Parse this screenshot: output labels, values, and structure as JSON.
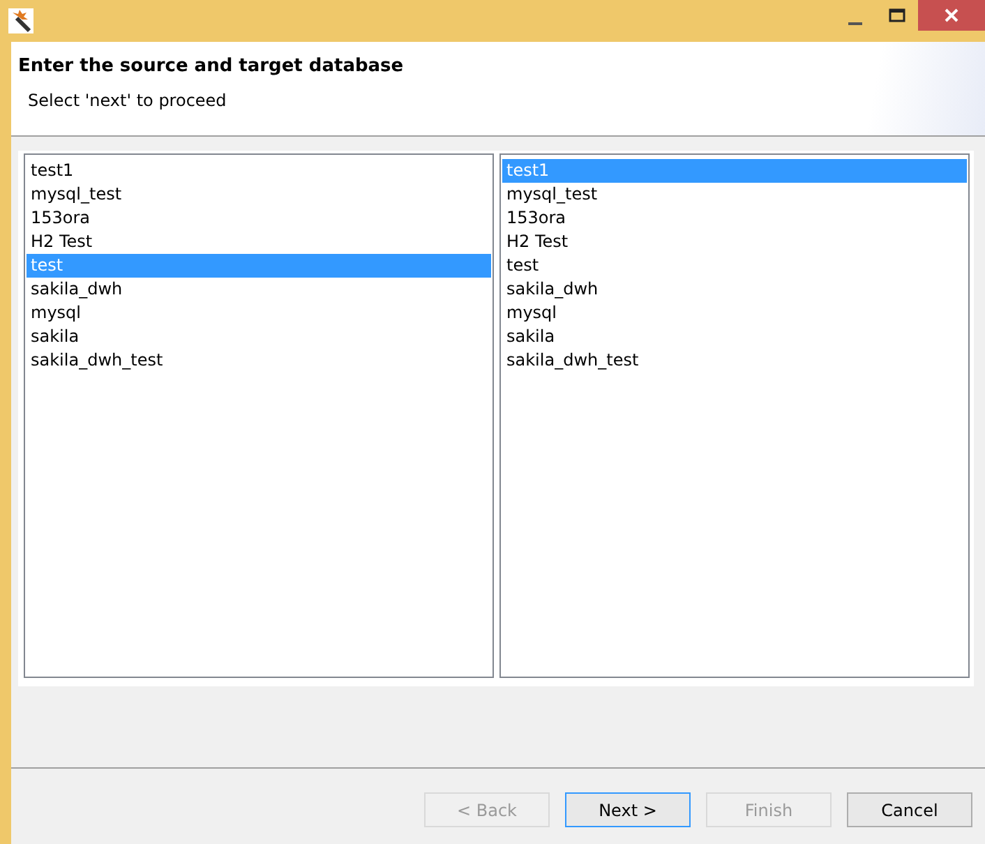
{
  "header": {
    "title": "Enter the source and target database",
    "subtitle": "Select 'next' to proceed"
  },
  "lists": [
    {
      "items": [
        {
          "label": "test1",
          "selected": false
        },
        {
          "label": "mysql_test",
          "selected": false
        },
        {
          "label": "153ora",
          "selected": false
        },
        {
          "label": "H2 Test",
          "selected": false
        },
        {
          "label": "test",
          "selected": true
        },
        {
          "label": "sakila_dwh",
          "selected": false
        },
        {
          "label": "mysql",
          "selected": false
        },
        {
          "label": "sakila",
          "selected": false
        },
        {
          "label": "sakila_dwh_test",
          "selected": false
        }
      ]
    },
    {
      "items": [
        {
          "label": "test1",
          "selected": true
        },
        {
          "label": "mysql_test",
          "selected": false
        },
        {
          "label": "153ora",
          "selected": false
        },
        {
          "label": "H2 Test",
          "selected": false
        },
        {
          "label": "test",
          "selected": false
        },
        {
          "label": "sakila_dwh",
          "selected": false
        },
        {
          "label": "mysql",
          "selected": false
        },
        {
          "label": "sakila",
          "selected": false
        },
        {
          "label": "sakila_dwh_test",
          "selected": false
        }
      ]
    }
  ],
  "buttons": [
    {
      "label": "< Back",
      "disabled": true,
      "default": false
    },
    {
      "label": "Next >",
      "disabled": false,
      "default": true
    },
    {
      "label": "Finish",
      "disabled": true,
      "default": false
    },
    {
      "label": "Cancel",
      "disabled": false,
      "default": false
    }
  ]
}
